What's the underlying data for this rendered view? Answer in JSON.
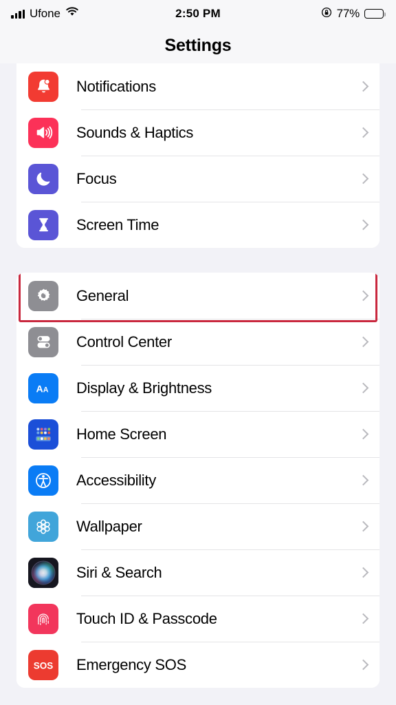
{
  "status_bar": {
    "carrier": "Ufone",
    "time": "2:50 PM",
    "battery_percent": "77%",
    "icons": [
      "signal-bars-icon",
      "wifi-icon",
      "rotation-lock-icon",
      "battery-icon"
    ],
    "battery_level": 77
  },
  "header": {
    "title": "Settings"
  },
  "highlight": {
    "target": "General",
    "color": "#c9283e"
  },
  "groups": [
    {
      "id": "group-1",
      "rows": [
        {
          "label": "Notifications",
          "icon": "bell-icon",
          "icon_color": "#f23b32",
          "chevron": "chevron-right-icon"
        },
        {
          "label": "Sounds & Haptics",
          "icon": "speaker-icon",
          "icon_color": "#fc3158",
          "chevron": "chevron-right-icon"
        },
        {
          "label": "Focus",
          "icon": "moon-icon",
          "icon_color": "#5a55d6",
          "chevron": "chevron-right-icon"
        },
        {
          "label": "Screen Time",
          "icon": "hourglass-icon",
          "icon_color": "#5a55d6",
          "chevron": "chevron-right-icon"
        }
      ]
    },
    {
      "id": "group-2",
      "rows": [
        {
          "label": "General",
          "icon": "gear-icon",
          "icon_color": "#8e8e93",
          "chevron": "chevron-right-icon",
          "highlighted": true
        },
        {
          "label": "Control Center",
          "icon": "toggles-icon",
          "icon_color": "#8e8e93",
          "chevron": "chevron-right-icon"
        },
        {
          "label": "Display & Brightness",
          "icon": "text-size-icon",
          "icon_color": "#0a7cf5",
          "chevron": "chevron-right-icon"
        },
        {
          "label": "Home Screen",
          "icon": "app-grid-icon",
          "icon_color": "#1b4fd8",
          "chevron": "chevron-right-icon"
        },
        {
          "label": "Accessibility",
          "icon": "accessibility-icon",
          "icon_color": "#0a7cf5",
          "chevron": "chevron-right-icon"
        },
        {
          "label": "Wallpaper",
          "icon": "flower-icon",
          "icon_color": "#41a5da",
          "chevron": "chevron-right-icon"
        },
        {
          "label": "Siri & Search",
          "icon": "siri-orb-icon",
          "icon_color": "#1c1c2b",
          "chevron": "chevron-right-icon"
        },
        {
          "label": "Touch ID & Passcode",
          "icon": "fingerprint-icon",
          "icon_color": "#f2365c",
          "chevron": "chevron-right-icon"
        },
        {
          "label": "Emergency SOS",
          "icon": "sos-icon",
          "icon_color": "#ec3b30",
          "chevron": "chevron-right-icon"
        }
      ]
    }
  ]
}
